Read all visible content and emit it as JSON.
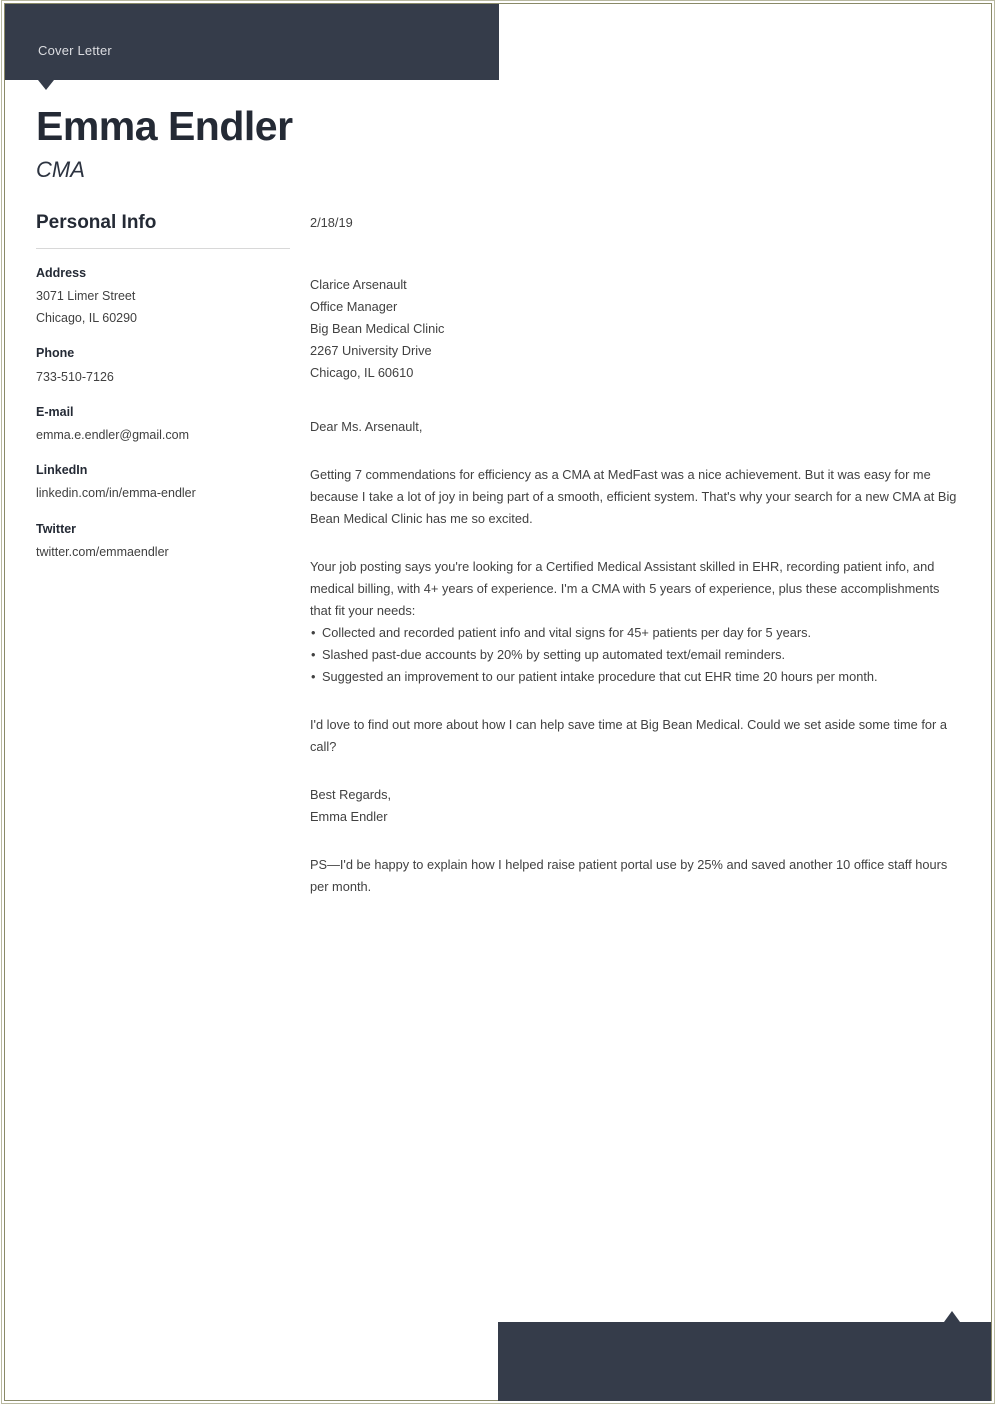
{
  "document": {
    "header_label": "Cover Letter",
    "candidate_name": "Emma Endler",
    "candidate_title": "CMA",
    "accent_color": "#353c4a",
    "border_color": "#8a8a68",
    "body_text_color": "#414141"
  },
  "sidebar": {
    "heading": "Personal Info",
    "groups": [
      {
        "label": "Address",
        "values": [
          "3071 Limer Street",
          "Chicago, IL 60290"
        ]
      },
      {
        "label": "Phone",
        "values": [
          "733-510-7126"
        ]
      },
      {
        "label": "E-mail",
        "values": [
          "emma.e.endler@gmail.com"
        ]
      },
      {
        "label": "LinkedIn",
        "values": [
          "linkedin.com/in/emma-endler"
        ]
      },
      {
        "label": "Twitter",
        "values": [
          "twitter.com/emmaendler"
        ]
      }
    ]
  },
  "letter": {
    "date": "2/18/19",
    "recipient": [
      "Clarice Arsenault",
      "Office Manager",
      "Big Bean Medical Clinic",
      "2267 University Drive",
      "Chicago, IL 60610"
    ],
    "salutation": "Dear Ms. Arsenault,",
    "paragraph_1": "Getting 7 commendations for efficiency as a CMA at MedFast was a nice achievement. But it was easy for me because I take a lot of joy in being part of a smooth, efficient system. That's why your search for a new CMA at Big Bean Medical Clinic has me so excited.",
    "paragraph_2": "Your job posting says you're looking for a Certified Medical Assistant skilled in EHR, recording patient info, and medical billing, with 4+ years of experience. I'm a CMA with 5 years of experience, plus these accomplishments that fit your needs:",
    "bullet_marker": "•",
    "accomplishments": [
      "Collected and recorded patient info and vital signs for 45+ patients per day for 5 years.",
      "Slashed past-due accounts by 20% by setting up automated text/email reminders.",
      "Suggested an improvement to our patient intake procedure that cut EHR time 20 hours per month."
    ],
    "paragraph_3": "I'd love to find out more about how I can help save time at Big Bean Medical. Could we set aside some time for a call?",
    "closing": "Best Regards,",
    "signature": "Emma Endler",
    "postscript": "PS—I'd be happy to explain how I helped raise patient portal use by 25% and saved another 10 office staff hours per month."
  }
}
